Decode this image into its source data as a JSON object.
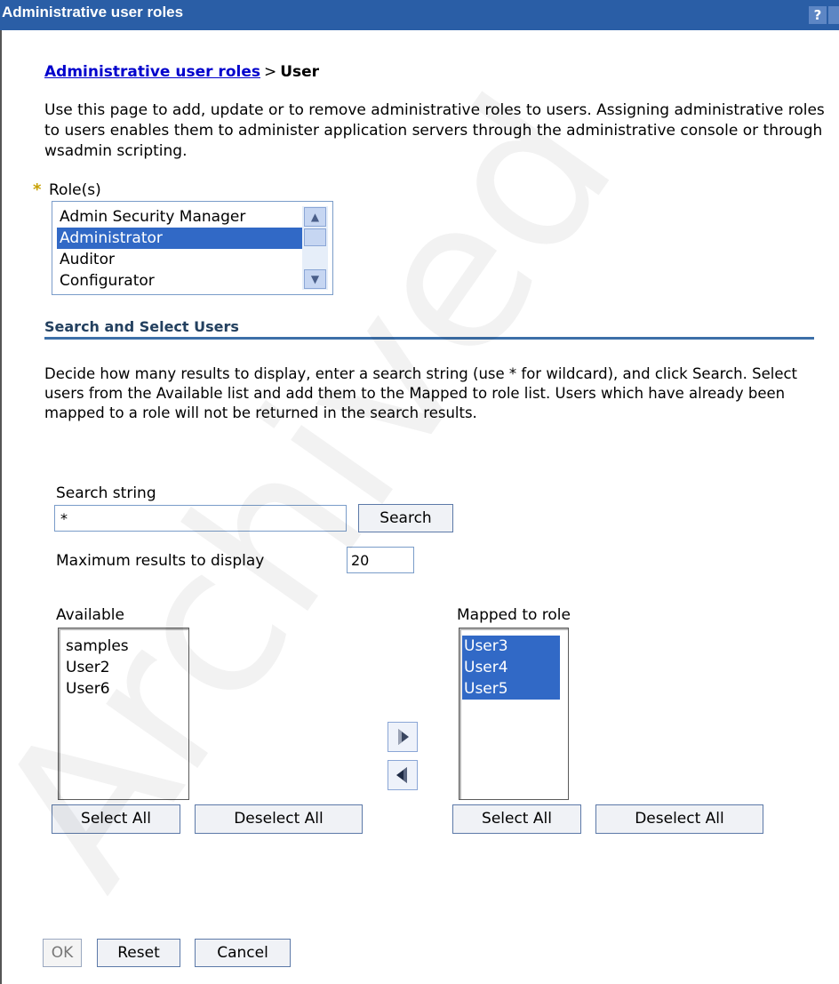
{
  "window": {
    "title": "Administrative user roles",
    "help_label": "?"
  },
  "breadcrumb": {
    "link": "Administrative user roles",
    "separator": ">",
    "current": "User"
  },
  "intro_text": "Use this page to add, update or to remove administrative roles to users. Assigning administrative roles to users enables them to administer application servers through the administrative console or through wsadmin scripting.",
  "roles": {
    "required_marker": "*",
    "label": "Role(s)",
    "items": [
      "Admin Security Manager",
      "Administrator",
      "Auditor",
      "Configurator"
    ],
    "selected": "Administrator"
  },
  "search_section": {
    "title": "Search and Select Users",
    "description": "Decide how many results to display, enter a search string (use * for wildcard), and click Search. Select users from the Available list and add them to the Mapped to role list. Users which have already been mapped to a role will not be returned in the search results.",
    "search_string_label": "Search string",
    "search_string_value": "*",
    "search_button": "Search",
    "max_results_label": "Maximum results to display",
    "max_results_value": "20"
  },
  "available": {
    "label": "Available",
    "items": [
      "samples",
      "User2",
      "User6"
    ],
    "select_all": "Select All",
    "deselect_all": "Deselect All"
  },
  "mapped": {
    "label": "Mapped to role",
    "items": [
      "User3",
      "User4",
      "User5"
    ],
    "select_all": "Select All",
    "deselect_all": "Deselect All"
  },
  "actions": {
    "ok": "OK",
    "reset": "Reset",
    "cancel": "Cancel"
  },
  "colors": {
    "titlebar": "#2a5ea6",
    "selection": "#3169c6",
    "link": "#0000cc",
    "required": "#c8a000"
  },
  "watermark": "Archived"
}
